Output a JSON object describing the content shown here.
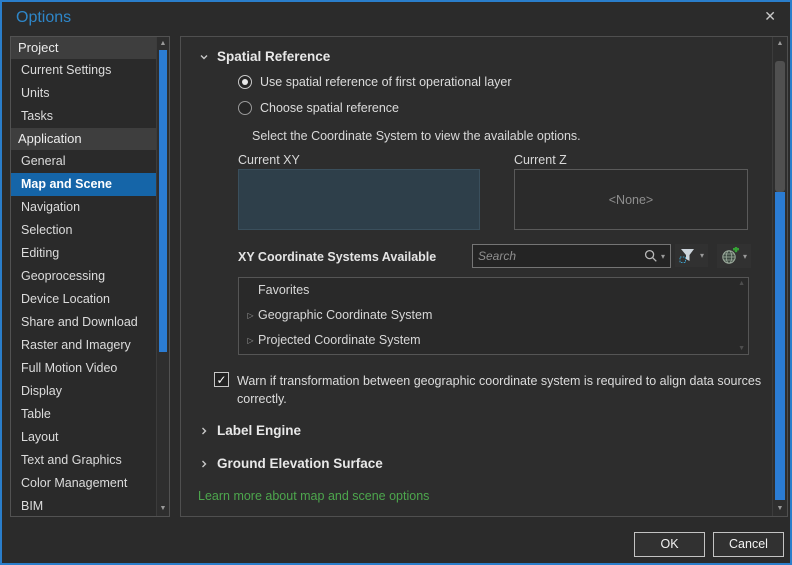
{
  "window": {
    "title": "Options"
  },
  "icons": {
    "close": "✕",
    "expander": "▷",
    "scroll_up": "▲",
    "scroll_down": "▼",
    "check": "✓",
    "dropdown_arrow": "▾"
  },
  "colors": {
    "accent_blue": "#2b7cd3",
    "selection_blue": "#1565a8",
    "title_blue": "#2e86c8",
    "link_green": "#4da64d",
    "current_xy_fill": "#2e3f4a",
    "window_border": "#2a7ecb"
  },
  "sidebar": {
    "selected": "Map and Scene",
    "rows": [
      {
        "type": "header",
        "label": "Project"
      },
      {
        "type": "item",
        "label": "Current Settings"
      },
      {
        "type": "item",
        "label": "Units"
      },
      {
        "type": "item",
        "label": "Tasks"
      },
      {
        "type": "header",
        "label": "Application"
      },
      {
        "type": "item",
        "label": "General"
      },
      {
        "type": "item",
        "label": "Map and Scene",
        "selected": true
      },
      {
        "type": "item",
        "label": "Navigation"
      },
      {
        "type": "item",
        "label": "Selection"
      },
      {
        "type": "item",
        "label": "Editing"
      },
      {
        "type": "item",
        "label": "Geoprocessing"
      },
      {
        "type": "item",
        "label": "Device Location"
      },
      {
        "type": "item",
        "label": "Share and Download"
      },
      {
        "type": "item",
        "label": "Raster and Imagery"
      },
      {
        "type": "item",
        "label": "Full Motion Video"
      },
      {
        "type": "item",
        "label": "Display"
      },
      {
        "type": "item",
        "label": "Table"
      },
      {
        "type": "item",
        "label": "Layout"
      },
      {
        "type": "item",
        "label": "Text and Graphics"
      },
      {
        "type": "item",
        "label": "Color Management"
      },
      {
        "type": "item",
        "label": "BIM"
      }
    ]
  },
  "main": {
    "spatial_reference": {
      "title": "Spatial Reference",
      "radios": [
        {
          "label": "Use spatial reference of first operational layer",
          "selected": true
        },
        {
          "label": "Choose spatial reference",
          "selected": false
        }
      ],
      "instruction": "Select the Coordinate System to view the available options.",
      "current_xy_label": "Current XY",
      "current_z_label": "Current Z",
      "current_z_value": "<None>",
      "xy_systems_label": "XY Coordinate Systems Available",
      "search_placeholder": "Search",
      "tree_items": [
        {
          "label": "Favorites",
          "expandable": false
        },
        {
          "label": "Geographic Coordinate System",
          "expandable": true
        },
        {
          "label": "Projected Coordinate System",
          "expandable": true
        }
      ],
      "warn_label": "Warn if transformation between geographic coordinate system is required to align data sources correctly.",
      "warn_checked": true
    },
    "collapsed_sections": [
      "Label Engine",
      "Ground Elevation Surface"
    ],
    "learn_more": "Learn more about map and scene options"
  },
  "footer": {
    "ok": "OK",
    "cancel": "Cancel"
  }
}
